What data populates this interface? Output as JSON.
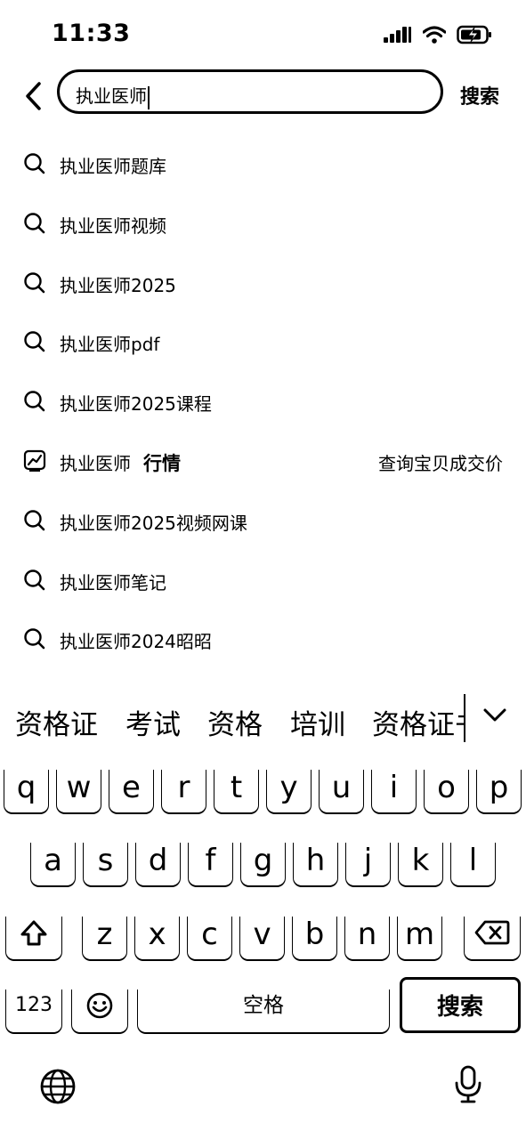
{
  "status_bar": {
    "time": "11:33"
  },
  "search": {
    "query": "执业医师",
    "button_label": "搜索"
  },
  "suggestions": [
    {
      "text": "执业医师题库"
    },
    {
      "text": "执业医师视频"
    },
    {
      "text": "执业医师2025"
    },
    {
      "text": "执业医师pdf"
    },
    {
      "text": "执业医师2025课程"
    },
    {
      "text": "执业医师",
      "tag": "行情",
      "right": "查询宝贝成交价",
      "icon": "market-trend-icon"
    },
    {
      "text": "执业医师2025视频网课"
    },
    {
      "text": "执业医师笔记"
    },
    {
      "text": "执业医师2024昭昭"
    }
  ],
  "candidates": [
    "资格证",
    "考试",
    "资格",
    "培训",
    "资格证书"
  ],
  "keyboard": {
    "row1": [
      "q",
      "w",
      "e",
      "r",
      "t",
      "y",
      "u",
      "i",
      "o",
      "p"
    ],
    "row2": [
      "a",
      "s",
      "d",
      "f",
      "g",
      "h",
      "j",
      "k",
      "l"
    ],
    "row3": [
      "z",
      "x",
      "c",
      "v",
      "b",
      "n",
      "m"
    ],
    "numbers_label": "123",
    "space_label": "空格",
    "search_label": "搜索"
  },
  "icons": [
    "back-arrow-icon",
    "signal-icon",
    "wifi-icon",
    "battery-charging-icon",
    "search-icon",
    "market-trend-icon",
    "chevron-down-icon",
    "shift-icon",
    "backspace-icon",
    "emoji-icon",
    "globe-icon",
    "microphone-icon"
  ]
}
